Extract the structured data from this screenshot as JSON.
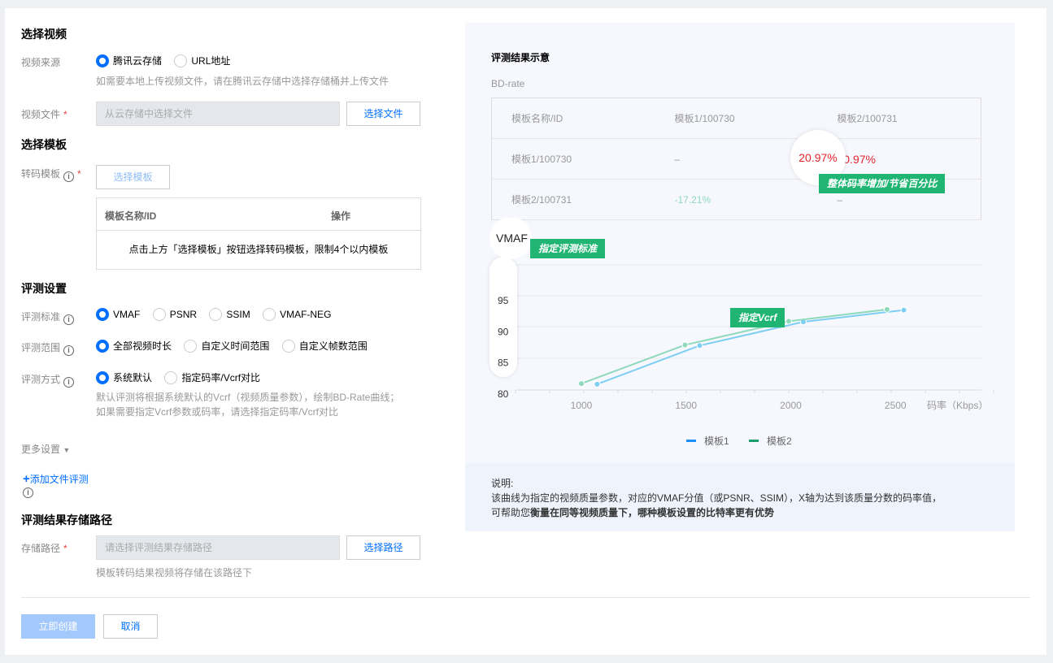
{
  "video": {
    "title": "选择视频",
    "source_label": "视频来源",
    "source_options": [
      "腾讯云存储",
      "URL地址"
    ],
    "source_hint": "如需要本地上传视频文件，请在腾讯云存储中选择存储桶并上传文件",
    "file_label": "视频文件",
    "file_placeholder": "从云存储中选择文件",
    "file_button": "选择文件"
  },
  "template": {
    "title": "选择模板",
    "label": "转码模板",
    "button": "选择模板",
    "col_name": "模板名称/ID",
    "col_op": "操作",
    "empty": "点击上方「选择模板」按钮选择转码模板，限制4个以内模板"
  },
  "eval": {
    "title": "评测设置",
    "standard_label": "评测标准",
    "standards": [
      "VMAF",
      "PSNR",
      "SSIM",
      "VMAF-NEG"
    ],
    "range_label": "评测范围",
    "ranges": [
      "全部视频时长",
      "自定义时间范围",
      "自定义帧数范围"
    ],
    "method_label": "评测方式",
    "methods": [
      "系统默认",
      "指定码率/Vcrf对比"
    ],
    "method_hint1": "默认评测将根据系统默认的Vcrf（视频质量参数），绘制BD-Rate曲线；",
    "method_hint2": "如果需要指定Vcrf参数或码率，请选择指定码率/Vcrf对比",
    "more": "更多设置",
    "add_file": "添加文件评测"
  },
  "storage": {
    "title": "评测结果存储路径",
    "label": "存储路径",
    "placeholder": "请选择评测结果存储路径",
    "button": "选择路径",
    "hint": "模板转码结果视频将存储在该路径下"
  },
  "footer": {
    "create": "立即创建",
    "cancel": "取消"
  },
  "example": {
    "title": "评测结果示意",
    "bd_label": "BD-rate",
    "header": [
      "模板名称/ID",
      "模板1/100730",
      "模板2/100731"
    ],
    "rows": [
      [
        "模板1/100730",
        "–",
        "20.97%"
      ],
      [
        "模板2/100731",
        "-17.21%",
        "–"
      ]
    ],
    "tag_bd": "整体码率增加/节省百分比",
    "tag_std": "指定评测标准",
    "tag_vcrf": "指定Vcrf",
    "note_title": "说明:",
    "note1": "该曲线为指定的视频质量参数，对应的VMAF分值（或PSNR、SSIM），X轴为达到该质量分数的码率值，",
    "note2a": "可帮助您",
    "note2b": "衡量在同等视频质量下，哪种模板设置的比特率更有优势"
  },
  "chart_data": {
    "type": "line",
    "ylabel": "VMAF",
    "xlabel": "码率（Kbps）",
    "xticks": [
      1000,
      1500,
      2000,
      2500
    ],
    "yticks": [
      95,
      90,
      85,
      80
    ],
    "xlim": [
      700,
      2900
    ],
    "ylim": [
      78,
      98
    ],
    "series": [
      {
        "name": "模板1",
        "color": "#7ecef4",
        "points": [
          [
            1075,
            80.8
          ],
          [
            1565,
            87.0
          ],
          [
            2060,
            90.8
          ],
          [
            2540,
            92.7
          ]
        ]
      },
      {
        "name": "模板2",
        "color": "#8fd9bb",
        "points": [
          [
            1000,
            80.9
          ],
          [
            1495,
            87.1
          ],
          [
            1990,
            90.9
          ],
          [
            2460,
            92.8
          ]
        ]
      }
    ],
    "legend_colors": [
      "#1890ff",
      "#1a9e6c"
    ]
  }
}
